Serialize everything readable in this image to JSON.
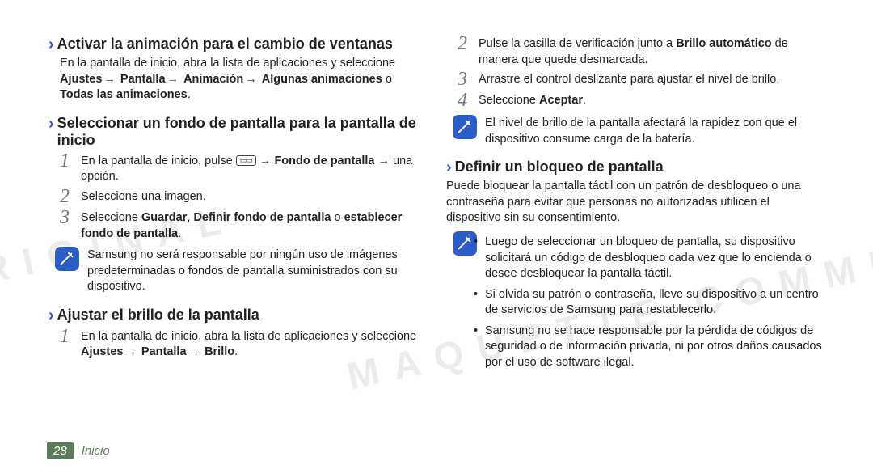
{
  "watermark1": "ORIGINAL",
  "watermark2": "MAQUETTE COMMERCIAL",
  "left": {
    "s1": {
      "title": "Activar la animación para el cambio de ventanas",
      "p1_a": "En la pantalla de inicio, abra la lista de aplicaciones y seleccione ",
      "b1": "Ajustes",
      "arr": " → ",
      "b2": "Pantalla",
      "b3": "Animación",
      "b4": "Algunas animaciones",
      "or": " o ",
      "b5": "Todas las animaciones",
      "period": "."
    },
    "s2": {
      "title": "Seleccionar un fondo de pantalla para la pantalla de inicio",
      "st1_a": "En la pantalla de inicio, pulse ",
      "st1_b": " → ",
      "st1_bold": "Fondo de pantalla",
      "st1_c": " → una opción.",
      "st2": "Seleccione una imagen.",
      "st3_a": "Seleccione ",
      "st3_b1": "Guardar",
      "st3_sep": ", ",
      "st3_b2": "Definir fondo de pantalla",
      "st3_or": " o ",
      "st3_b3": "establecer fondo de pantalla",
      "note": "Samsung no será responsable por ningún uso de imágenes predeterminadas o fondos de pantalla suministrados con su dispositivo."
    },
    "s3": {
      "title": "Ajustar el brillo de la pantalla",
      "st1_a": "En la pantalla de inicio, abra la lista de aplicaciones y seleccione ",
      "st1_b1": "Ajustes",
      "arr": " → ",
      "st1_b2": "Pantalla",
      "st1_b3": "Brillo",
      "period": "."
    }
  },
  "right": {
    "st2_a": "Pulse la casilla de verificación junto a ",
    "st2_b": "Brillo automático",
    "st2_c": " de manera que quede desmarcada.",
    "st3": "Arrastre el control deslizante para ajustar el nivel de brillo.",
    "st4_a": "Seleccione ",
    "st4_b": "Aceptar",
    "st4_c": ".",
    "note1": "El nivel de brillo de la pantalla afectará la rapidez con que el dispositivo consume carga de la batería.",
    "lock": {
      "title": "Definir un bloqueo de pantalla",
      "intro": "Puede bloquear la pantalla táctil con un patrón de desbloqueo o una contraseña para evitar que personas no autorizadas utilicen el dispositivo sin su consentimiento.",
      "b1": "Luego de seleccionar un bloqueo de pantalla, su dispositivo solicitará un código de desbloqueo cada vez que lo encienda o desee desbloquear la pantalla táctil.",
      "b2": "Si olvida su patrón o contraseña, lleve su dispositivo a un centro de servicios de Samsung para restablecerlo.",
      "b3": "Samsung no se hace responsable por la pérdida de códigos de seguridad o de información privada, ni por otros daños causados por el uso de software ilegal."
    }
  },
  "footer": {
    "page": "28",
    "section": "Inicio"
  }
}
